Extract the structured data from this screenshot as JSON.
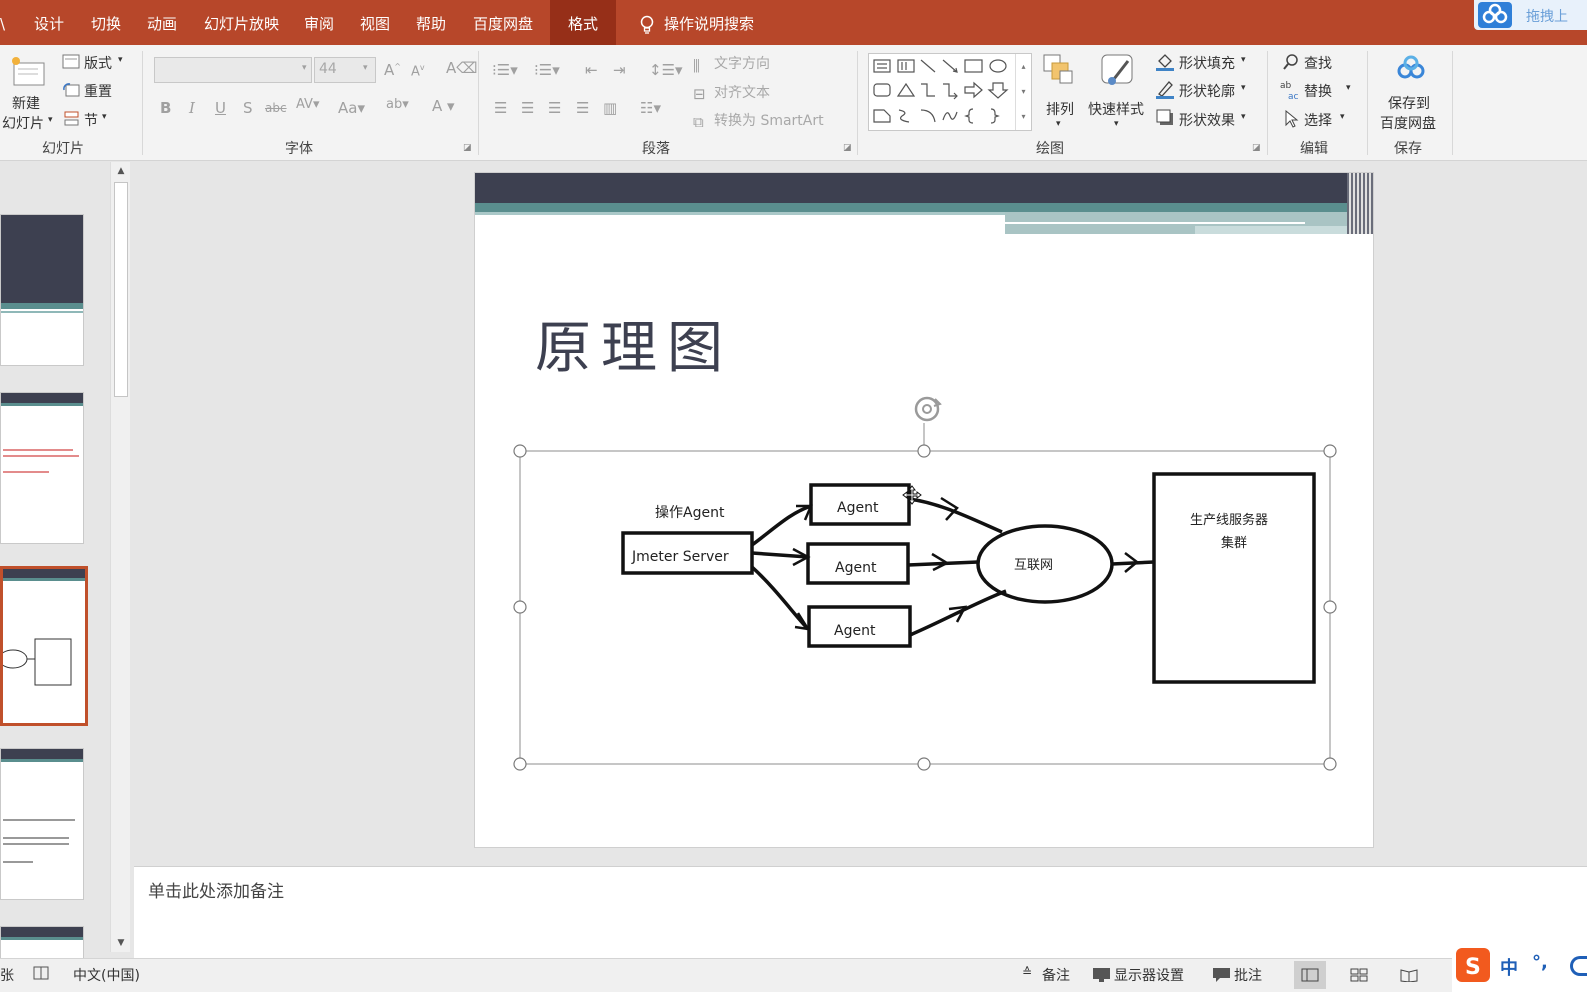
{
  "menubar": {
    "tabs": [
      "设计",
      "切换",
      "动画",
      "幻灯片放映",
      "审阅",
      "视图",
      "帮助",
      "百度网盘",
      "格式"
    ],
    "active_tab": "格式",
    "tell_me": "操作说明搜索",
    "cloud_button": "拖拽上",
    "bg_color": "#b7472a"
  },
  "ribbon": {
    "slides_group": {
      "label": "幻灯片",
      "new_slide": [
        "新建",
        "幻灯片"
      ],
      "layout": "版式",
      "reset": "重置",
      "section": "节"
    },
    "font_group": {
      "label": "字体",
      "font_size": "44"
    },
    "paragraph_group": {
      "label": "段落",
      "text_direction": "文字方向",
      "align_text": "对齐文本",
      "convert_smartart": "转换为 SmartArt"
    },
    "drawing_group": {
      "label": "绘图",
      "arrange": "排列",
      "quick_styles": "快速样式",
      "shape_fill": "形状填充",
      "shape_outline": "形状轮廓",
      "shape_effects": "形状效果"
    },
    "editing_group": {
      "label": "编辑",
      "find": "查找",
      "replace": "替换",
      "select": "选择"
    },
    "save_group": {
      "label": "保存",
      "save_to": [
        "保存到",
        "百度网盘"
      ]
    }
  },
  "slide": {
    "title": "原理图",
    "diagram": {
      "operate_label": "操作Agent",
      "server": "Jmeter Server",
      "agents": [
        "Agent",
        "Agent",
        "Agent"
      ],
      "internet": "互联网",
      "cluster": [
        "生产线服务器",
        "集群"
      ]
    }
  },
  "notes_placeholder": "单击此处添加备注",
  "statusbar": {
    "left_cut": "张",
    "language": "中文(中国)",
    "notes": "备注",
    "display_settings": "显示器设置",
    "comments": "批注"
  },
  "ime": {
    "mode": "中",
    "punct": "°,"
  }
}
